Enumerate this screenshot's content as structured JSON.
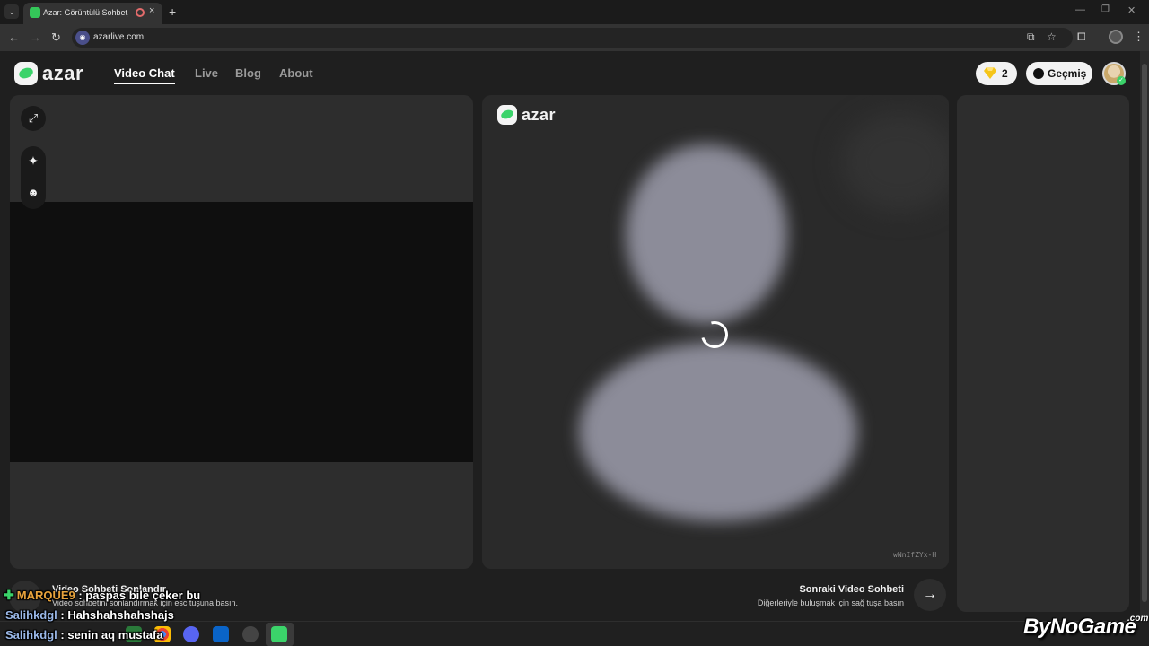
{
  "browser": {
    "tab_title": "Azar: Görüntülü Sohbet, Ar",
    "url": "azarlive.com",
    "new_tab_icon": "+",
    "close_tab_icon": "×"
  },
  "header": {
    "logo_text": "azar",
    "nav": {
      "video_chat": "Video Chat",
      "live": "Live",
      "blog": "Blog",
      "about": "About"
    },
    "gems_count": "2",
    "history_label": "Geçmiş"
  },
  "center": {
    "logo_text": "azar",
    "session_code": "wNnIfZYx-H"
  },
  "bottom": {
    "end_title": "Video Sohbeti Sonlandır",
    "end_desc": "Video sohbetini sonlandırmak için esc tuşuna basın.",
    "next_title": "Sonraki Video Sohbeti",
    "next_desc": "Diğerleriyle buluşmak için sağ tuşa basın"
  },
  "chat": [
    {
      "user": "MARQUE9",
      "message": " : paspas bile çeker bu"
    },
    {
      "user": "Salihkdgl",
      "message": " : Hahshahshahshajs"
    },
    {
      "user": "Salihkdgl",
      "message": " : senin aq mustafa"
    }
  ],
  "watermark": {
    "brand": "ByNoGame",
    "suffix": ".com"
  },
  "colors": {
    "accent_green": "#3bd36a",
    "background": "#1f1f1f",
    "panel": "#2d2d2d"
  },
  "icons": [
    "expand-icon",
    "sparkle-icon",
    "face-icon",
    "gem-icon",
    "history-icon",
    "arrow-right-icon",
    "loading-spinner"
  ]
}
